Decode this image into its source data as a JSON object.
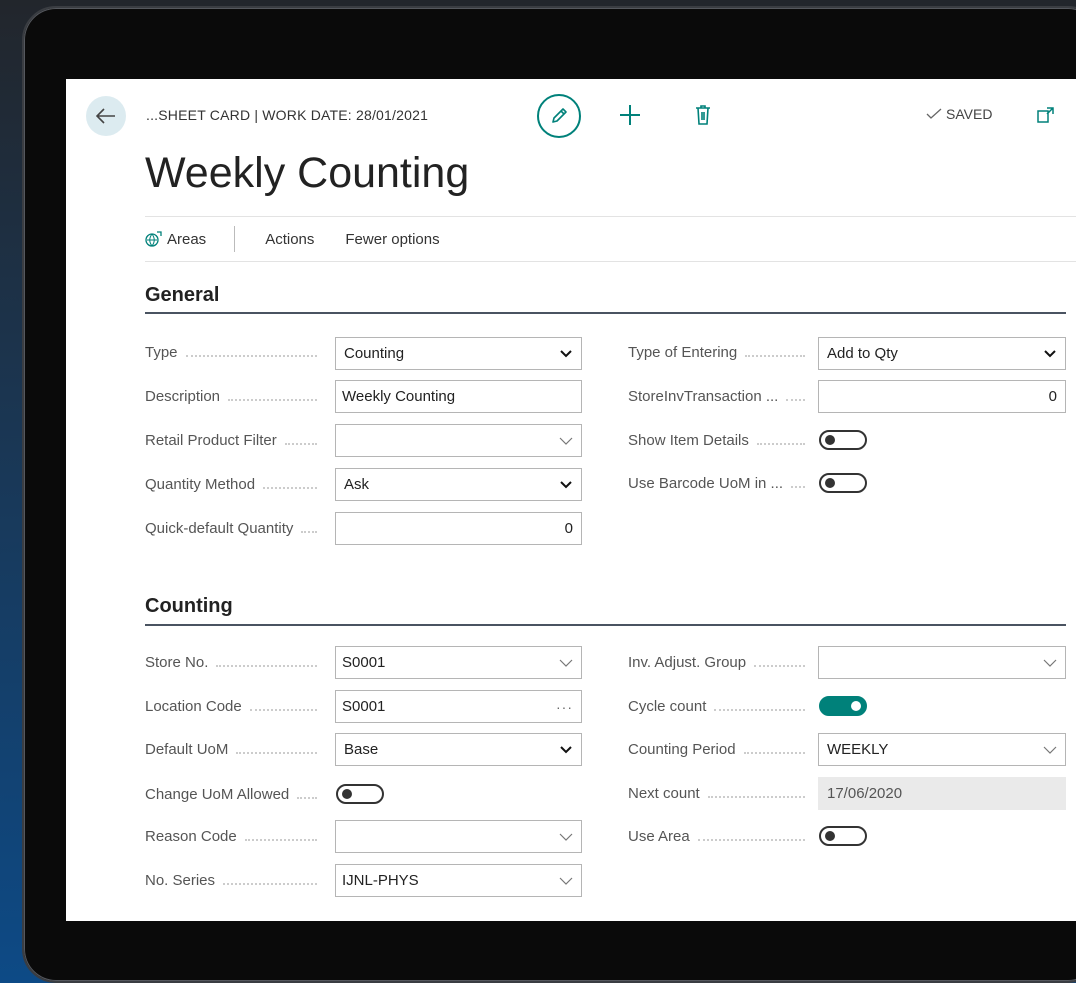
{
  "header": {
    "breadcrumb": "...SHEET CARD | WORK DATE: 28/01/2021",
    "saved_label": "SAVED"
  },
  "page_title": "Weekly Counting",
  "actionbar": {
    "areas": "Areas",
    "actions": "Actions",
    "fewer_options": "Fewer options"
  },
  "general": {
    "title": "General",
    "type_label": "Type",
    "type_value": "Counting",
    "description_label": "Description",
    "description_value": "Weekly Counting",
    "retail_filter_label": "Retail Product Filter",
    "retail_filter_value": "",
    "quantity_method_label": "Quantity Method",
    "quantity_method_value": "Ask",
    "quick_default_label": "Quick-default Quantity",
    "quick_default_value": "0",
    "type_of_entering_label": "Type of Entering",
    "type_of_entering_value": "Add to Qty",
    "store_inv_label": "StoreInvTransaction ...",
    "store_inv_value": "0",
    "show_item_details_label": "Show Item Details",
    "show_item_details_on": false,
    "use_barcode_label": "Use Barcode UoM in ...",
    "use_barcode_on": false
  },
  "counting": {
    "title": "Counting",
    "store_no_label": "Store No.",
    "store_no_value": "S0001",
    "location_label": "Location Code",
    "location_value": "S0001",
    "default_uom_label": "Default UoM",
    "default_uom_value": "Base",
    "change_uom_label": "Change UoM Allowed",
    "change_uom_on": false,
    "reason_code_label": "Reason Code",
    "reason_code_value": "",
    "no_series_label": "No. Series",
    "no_series_value": "IJNL-PHYS",
    "inv_adjust_label": "Inv. Adjust. Group",
    "inv_adjust_value": "",
    "cycle_count_label": "Cycle count",
    "cycle_count_on": true,
    "counting_period_label": "Counting Period",
    "counting_period_value": "WEEKLY",
    "next_count_label": "Next count",
    "next_count_value": "17/06/2020",
    "use_area_label": "Use Area",
    "use_area_on": false
  },
  "colors": {
    "accent": "#00817a",
    "toggle_off": "#333333"
  }
}
